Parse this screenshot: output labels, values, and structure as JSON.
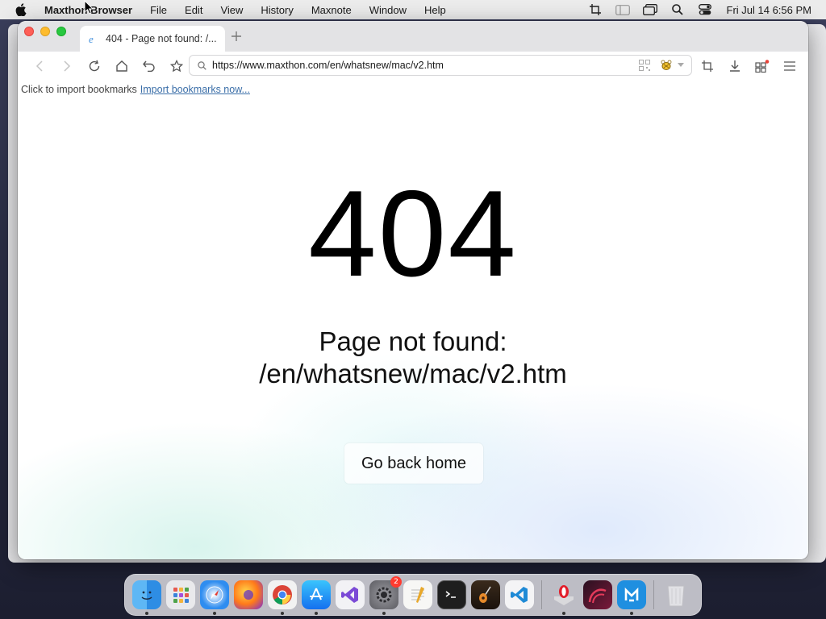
{
  "menubar": {
    "app_name": "Maxthon Browser",
    "menus": [
      "File",
      "Edit",
      "View",
      "History",
      "Maxnote",
      "Window",
      "Help"
    ],
    "clock": "Fri Jul 14  6:56 PM",
    "status_icons": [
      "screenshot-icon",
      "sidebar-icon",
      "window-icon",
      "search-icon",
      "control-center-icon"
    ]
  },
  "tab": {
    "title": "404 - Page not found: /...",
    "favicon": "maxthon-e-icon"
  },
  "toolbar": {
    "url": "https://www.maxthon.com/en/whatsnew/mac/v2.htm",
    "left_buttons": [
      "back-icon",
      "forward-icon",
      "reload-icon",
      "home-icon",
      "undo-icon",
      "star-icon"
    ],
    "right_buttons": [
      "capture-icon",
      "download-icon",
      "apps-icon",
      "menu-icon"
    ]
  },
  "bookmarkbar": {
    "prompt": "Click to import bookmarks",
    "link": "Import bookmarks now..."
  },
  "page": {
    "code": "404",
    "message_line1": "Page not found:",
    "message_line2": "/en/whatsnew/mac/v2.htm",
    "button": "Go back home"
  },
  "dock": {
    "apps": [
      "Finder",
      "Launchpad",
      "Safari",
      "Firefox",
      "Chrome",
      "App Store",
      "Visual Studio",
      "System Settings",
      "TextEdit",
      "Terminal",
      "GarageBand",
      "VS Code",
      "Opera",
      "Microsoft Edge",
      "Maxthon",
      "Trash"
    ],
    "system_settings_badge": "2"
  },
  "colors": {
    "traffic_close": "#fe5f57",
    "traffic_min": "#febc2e",
    "traffic_max": "#28c840",
    "link": "#3a6ea8"
  }
}
